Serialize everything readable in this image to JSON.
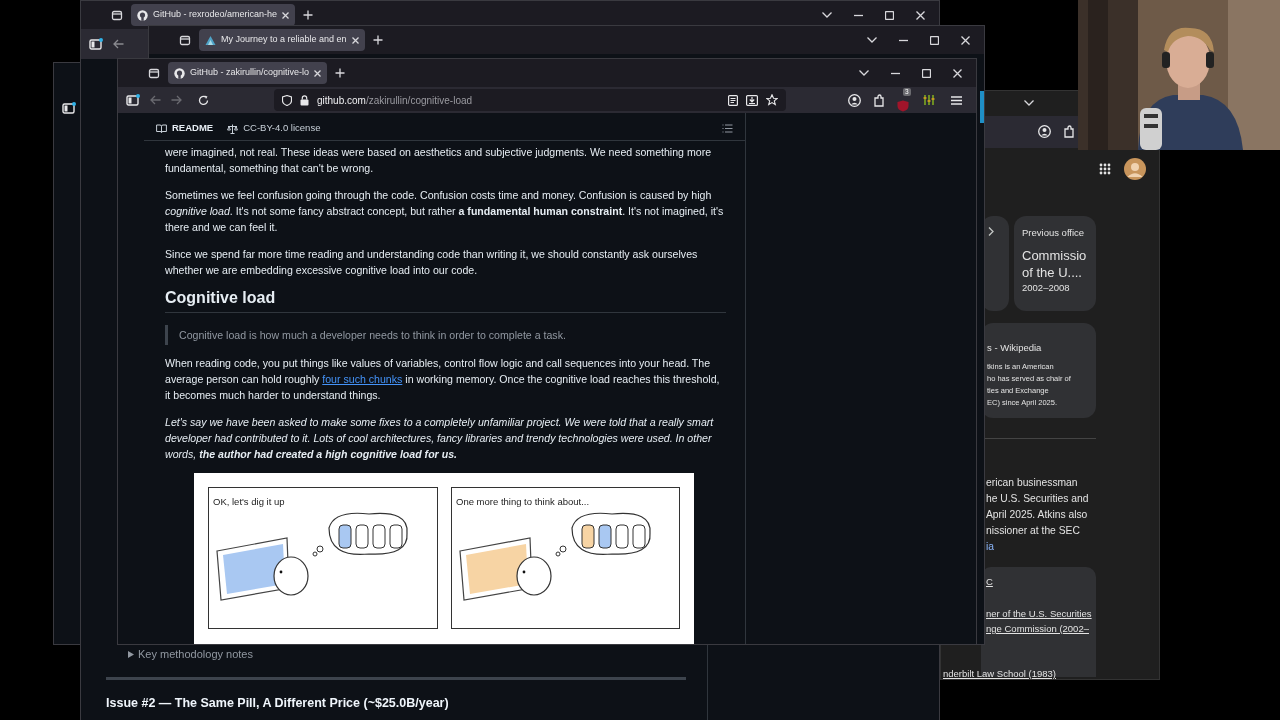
{
  "side_window": {
    "kind": "window"
  },
  "back_window": {
    "tabs": [
      {
        "title": "GitHub - rexrodeo/american-he",
        "selected": true
      }
    ],
    "details_summary": "Key methodology notes",
    "heading": "Issue #2 — The Same Pill, A Different Price (~$25.0B/year)"
  },
  "middle_window": {
    "tabs": [
      {
        "title": "My Journey to a reliable and en",
        "selected": true
      }
    ]
  },
  "search_window": {
    "office_card": {
      "label": "Previous office",
      "title": "Commissio of the U....",
      "years": "2002–2008"
    },
    "wiki_card": {
      "source": "s - Wikipedia",
      "snippet": [
        "tkins is an American",
        "ho has served as chair of",
        "ties and Exchange",
        "EC) since April 2025."
      ]
    },
    "description": [
      "erican businessman",
      "he U.S. Securities and",
      "April 2025. Atkins also",
      "nissioner at the SEC"
    ],
    "description_link": "ia",
    "facts_heading": "C",
    "facts": [
      "ner of the U.S. Securities",
      "nge Commission (2002–"
    ],
    "education": "nderbilt Law School (1983)"
  },
  "front_window": {
    "tabs": [
      {
        "title": "GitHub - zakirullin/cognitive-lo",
        "selected": true
      }
    ],
    "url_host": "github.com",
    "url_path": "/zakirullin/cognitive-load",
    "extension_badge": "3",
    "readme_tabs": [
      {
        "label": "README",
        "selected": true
      },
      {
        "label": "CC-BY-4.0 license",
        "selected": false
      }
    ],
    "article": [
      {
        "kind": "paragraph",
        "text": "were imagined, not real. These ideas were based on aesthetics and subjective judgments. We need something more fundamental, something that can't be wrong."
      },
      {
        "kind": "paragraph",
        "text": "Sometimes we feel confusion going through the code. Confusion costs time and money. Confusion is caused by high *cognitive load*. It's not some fancy abstract concept, but rather **a fundamental human constraint**. It's not imagined, it's there and we can feel it."
      },
      {
        "kind": "paragraph",
        "text": "Since we spend far more time reading and understanding code than writing it, we should constantly ask ourselves whether we are embedding excessive cognitive load into our code."
      },
      {
        "kind": "heading",
        "text": "Cognitive load"
      },
      {
        "kind": "quote",
        "text": "Cognitive load is how much a developer needs to think in order to complete a task."
      },
      {
        "kind": "linked_paragraph",
        "parts": [
          {
            "text": "When reading code, you put things like values of variables, control flow logic and call sequences into your head. The average person can hold roughly ",
            "link": false
          },
          {
            "text": "four such chunks",
            "link": true
          },
          {
            "text": " in working memory. Once the cognitive load reaches this threshold, it becomes much harder to understand things.",
            "link": false
          }
        ]
      },
      {
        "kind": "italic_paragraph",
        "text": "Let's say we have been asked to make some fixes to a completely unfamiliar project. We were told that a really smart developer had contributed to it. Lots of cool architectures, fancy libraries and trendy technologies were used. In other words, **the author had created a high cognitive load for us.**"
      },
      {
        "kind": "comic",
        "panels": [
          {
            "caption": "OK, let's dig it up",
            "slots": [
              {
                "filled": true,
                "color": "#a9c8f2"
              },
              {
                "filled": false
              },
              {
                "filled": false
              },
              {
                "filled": false
              }
            ]
          },
          {
            "caption": "One more thing to think about...",
            "slots": [
              {
                "filled": true,
                "color": "#f7d4a4"
              },
              {
                "filled": true,
                "color": "#a9c8f2"
              },
              {
                "filled": false
              },
              {
                "filled": false
              }
            ]
          }
        ]
      }
    ]
  }
}
